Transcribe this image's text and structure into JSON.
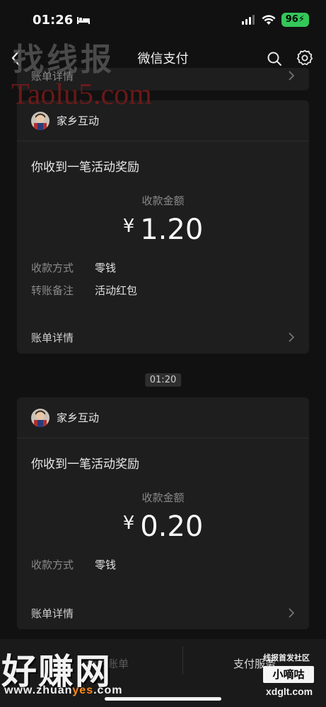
{
  "status_bar": {
    "time": "01:26",
    "battery": "96"
  },
  "nav": {
    "title": "微信支付"
  },
  "watermarks": {
    "top_cn": "找线报",
    "top_url": "Taolu5.com",
    "bottom_left_big": "好赚网",
    "bottom_left_url_a": "www.zhuan",
    "bottom_left_url_b": "yes",
    "bottom_left_url_c": ".com",
    "bottom_right_top": "线报首发社区",
    "bottom_right_box": "小嘀咕",
    "bottom_right_url": "xdglt.com"
  },
  "partial_card": {
    "detail_label": "账单详情"
  },
  "cards": [
    {
      "sender": "家乡互动",
      "title": "你收到一笔活动奖励",
      "amount_label": "收款金额",
      "currency": "¥",
      "amount": "1.20",
      "fields": [
        {
          "key": "收款方式",
          "value": "零钱"
        },
        {
          "key": "转账备注",
          "value": "活动红包"
        }
      ],
      "detail_label": "账单详情"
    },
    {
      "sender": "家乡互动",
      "title": "你收到一笔活动奖励",
      "amount_label": "收款金额",
      "currency": "¥",
      "amount": "0.20",
      "fields": [
        {
          "key": "收款方式",
          "value": "零钱"
        }
      ],
      "detail_label": "账单详情"
    }
  ],
  "time_separator": "01:20",
  "bottom_bar": {
    "left_item": "我的账单",
    "right_item": "支付服务"
  }
}
